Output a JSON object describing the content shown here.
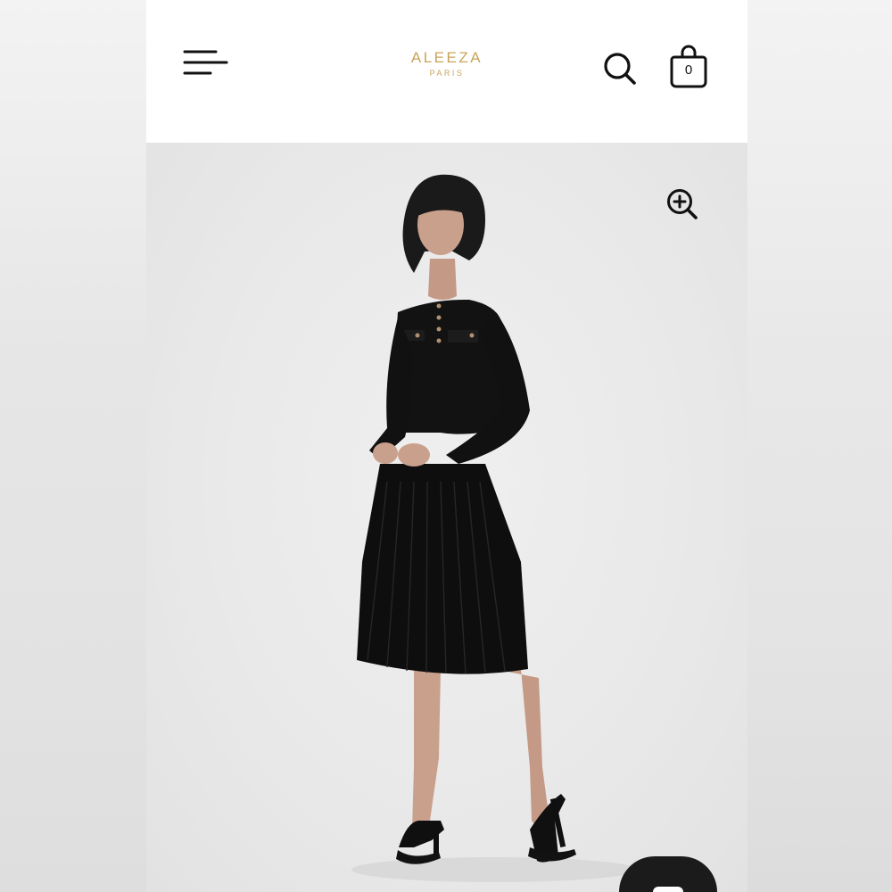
{
  "header": {
    "brand": "ALEEZA",
    "city": "PARIS",
    "cart_count": "0",
    "menu_icon": "hamburger-menu-icon",
    "search_icon": "search-icon",
    "cart_icon": "shopping-bag-icon"
  },
  "product": {
    "zoom_icon": "zoom-in-icon",
    "image_subject": "model-in-black-pleated-dress"
  },
  "chat": {
    "icon": "chat-icon"
  },
  "colors": {
    "brand_gold": "#c9a45c",
    "icon_dark": "#111111",
    "chat_button": "#1b1b1b"
  }
}
